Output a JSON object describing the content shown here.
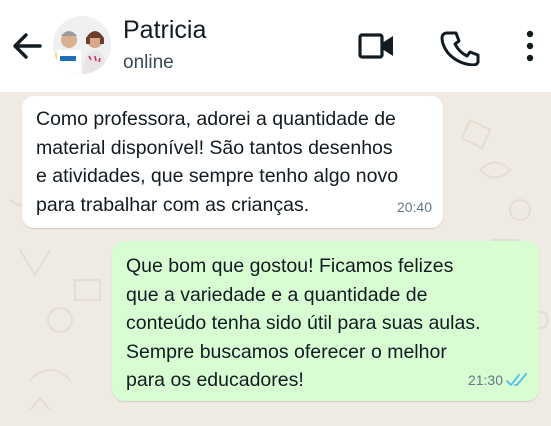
{
  "header": {
    "contact_name": "Patricia",
    "status": "online",
    "icons": {
      "back": "arrow-left-icon",
      "video": "video-camera-icon",
      "call": "phone-icon",
      "menu": "more-vertical-icon"
    }
  },
  "messages": [
    {
      "direction": "incoming",
      "text": "Como professora, adorei a quantidade de\nmaterial disponível! São tantos desenhos\ne atividades, que sempre tenho algo novo\npara trabalhar com as crianças.",
      "time": "20:40"
    },
    {
      "direction": "outgoing",
      "text": "Que bom que gostou! Ficamos felizes\nque a variedade e a quantidade de\nconteúdo tenha sido útil para suas aulas.\nSempre buscamos oferecer o melhor\npara os educadores!",
      "time": "21:30",
      "status": "read"
    }
  ],
  "colors": {
    "header_bg": "#ffffff",
    "chat_bg": "#efeae2",
    "incoming_bubble": "#ffffff",
    "outgoing_bubble": "#d9fdd3",
    "read_ticks": "#53bdeb",
    "primary_text": "#111b21",
    "secondary_text": "#667781"
  }
}
